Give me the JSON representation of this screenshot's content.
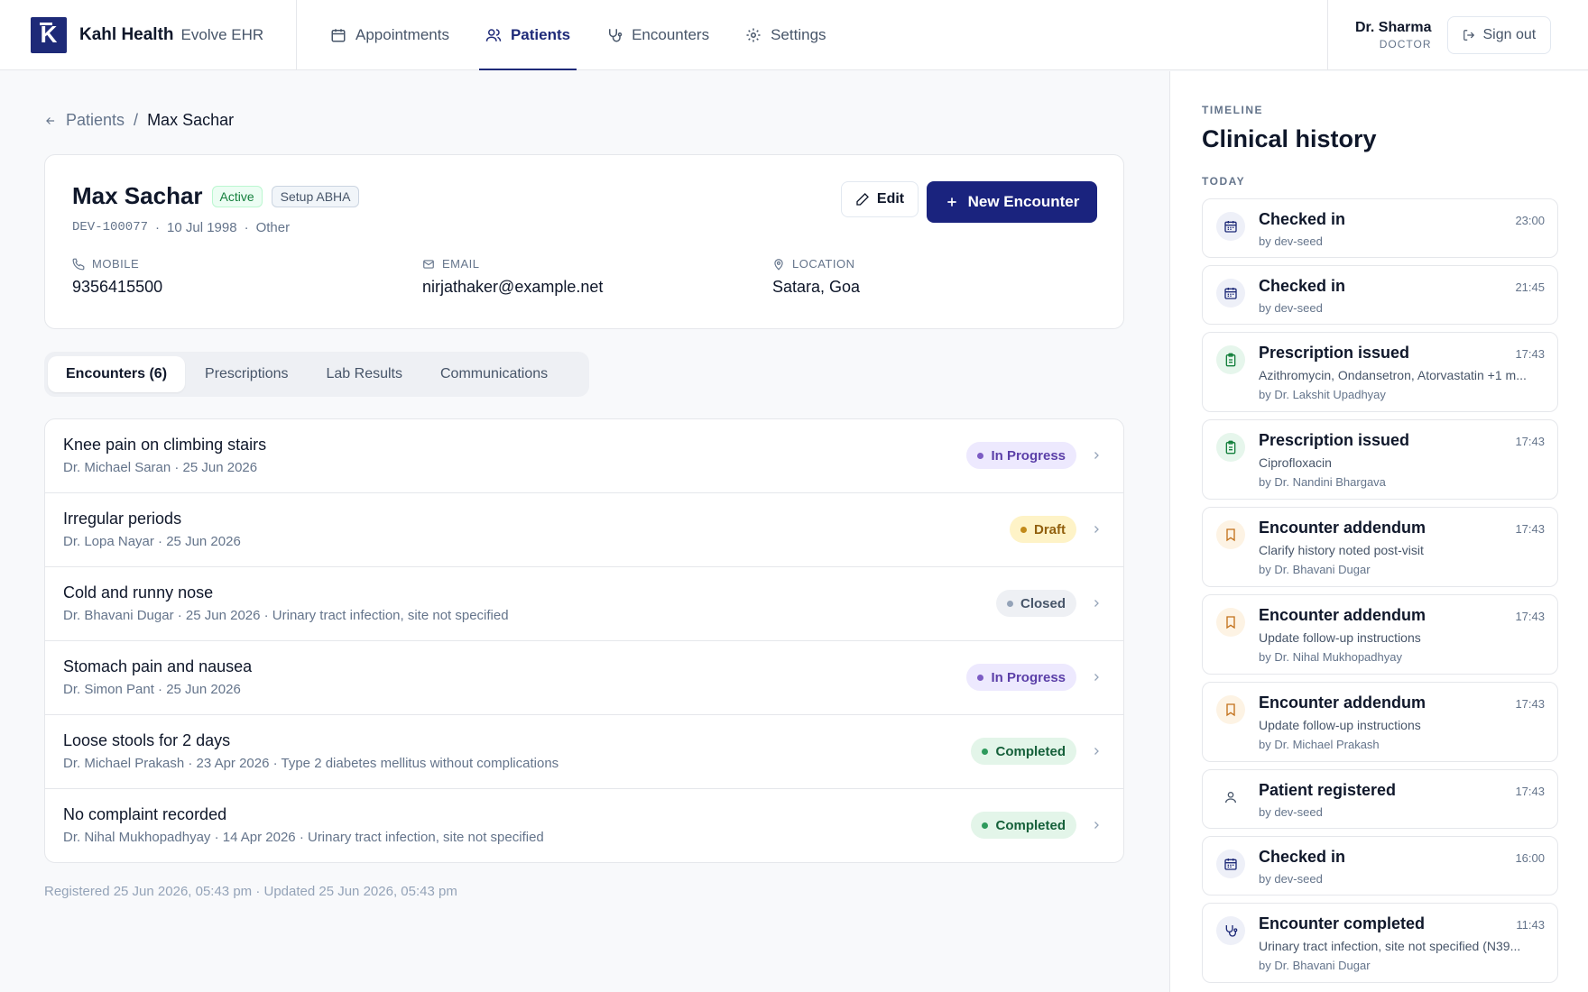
{
  "brand": {
    "name": "Kahl Health",
    "product": "Evolve EHR",
    "logo_letter": "K"
  },
  "nav": [
    {
      "label": "Appointments",
      "icon": "calendar-icon",
      "active": false
    },
    {
      "label": "Patients",
      "icon": "users-icon",
      "active": true
    },
    {
      "label": "Encounters",
      "icon": "stethoscope-icon",
      "active": false
    },
    {
      "label": "Settings",
      "icon": "gear-icon",
      "active": false
    }
  ],
  "user": {
    "name": "Dr. Sharma",
    "role": "DOCTOR",
    "signout_label": "Sign out"
  },
  "breadcrumb": {
    "parent": "Patients",
    "current": "Max Sachar"
  },
  "patient": {
    "name": "Max Sachar",
    "status": "Active",
    "abha": "Setup ABHA",
    "id": "DEV-100077",
    "dob": "10 Jul 1998",
    "gender": "Other",
    "edit_label": "Edit",
    "new_encounter_label": "New Encounter",
    "mobile_label": "MOBILE",
    "mobile": "9356415500",
    "email_label": "EMAIL",
    "email": "nirjathaker@example.net",
    "location_label": "LOCATION",
    "location": "Satara, Goa"
  },
  "tabs": [
    {
      "label": "Encounters (6)",
      "active": true
    },
    {
      "label": "Prescriptions",
      "active": false
    },
    {
      "label": "Lab Results",
      "active": false
    },
    {
      "label": "Communications",
      "active": false
    }
  ],
  "encounters": [
    {
      "title": "Knee pain on climbing stairs",
      "sub": "Dr. Michael Saran · 25 Jun 2026",
      "status": "In Progress"
    },
    {
      "title": "Irregular periods",
      "sub": "Dr. Lopa Nayar · 25 Jun 2026",
      "status": "Draft"
    },
    {
      "title": "Cold and runny nose",
      "sub": "Dr. Bhavani Dugar · 25 Jun 2026 · Urinary tract infection, site not specified",
      "status": "Closed"
    },
    {
      "title": "Stomach pain and nausea",
      "sub": "Dr. Simon Pant · 25 Jun 2026",
      "status": "In Progress"
    },
    {
      "title": "Loose stools for 2 days",
      "sub": "Dr. Michael Prakash · 23 Apr 2026 · Type 2 diabetes mellitus without complications",
      "status": "Completed"
    },
    {
      "title": "No complaint recorded",
      "sub": "Dr. Nihal Mukhopadhyay · 14 Apr 2026 · Urinary tract infection, site not specified",
      "status": "Completed"
    }
  ],
  "footer": "Registered 25 Jun 2026, 05:43 pm · Updated 25 Jun 2026, 05:43 pm",
  "timeline": {
    "kicker": "TIMELINE",
    "title": "Clinical history",
    "day": "TODAY",
    "items": [
      {
        "title": "Checked in",
        "time": "23:00",
        "desc": "",
        "by": "by dev-seed",
        "icon": "calendar-icon"
      },
      {
        "title": "Checked in",
        "time": "21:45",
        "desc": "",
        "by": "by dev-seed",
        "icon": "calendar-icon"
      },
      {
        "title": "Prescription issued",
        "time": "17:43",
        "desc": "Azithromycin, Ondansetron, Atorvastatin +1 m...",
        "by": "by Dr. Lakshit Upadhyay",
        "icon": "clipboard-icon"
      },
      {
        "title": "Prescription issued",
        "time": "17:43",
        "desc": "Ciprofloxacin",
        "by": "by Dr. Nandini Bhargava",
        "icon": "clipboard-icon"
      },
      {
        "title": "Encounter addendum",
        "time": "17:43",
        "desc": "Clarify history noted post-visit",
        "by": "by Dr. Bhavani Dugar",
        "icon": "bookmark-icon"
      },
      {
        "title": "Encounter addendum",
        "time": "17:43",
        "desc": "Update follow-up instructions",
        "by": "by Dr. Nihal Mukhopadhyay",
        "icon": "bookmark-icon"
      },
      {
        "title": "Encounter addendum",
        "time": "17:43",
        "desc": "Update follow-up instructions",
        "by": "by Dr. Michael Prakash",
        "icon": "bookmark-icon"
      },
      {
        "title": "Patient registered",
        "time": "17:43",
        "desc": "",
        "by": "by dev-seed",
        "icon": "user-icon"
      },
      {
        "title": "Checked in",
        "time": "16:00",
        "desc": "",
        "by": "by dev-seed",
        "icon": "calendar-icon"
      },
      {
        "title": "Encounter completed",
        "time": "11:43",
        "desc": "Urinary tract infection, site not specified (N39...",
        "by": "by Dr. Bhavani Dugar",
        "icon": "stethoscope-icon"
      }
    ]
  },
  "colors": {
    "brand": "#1a237e",
    "in_progress": "#7c5cc4",
    "draft": "#c28a1a",
    "closed": "#94a3b8",
    "completed": "#2e9a5c"
  }
}
